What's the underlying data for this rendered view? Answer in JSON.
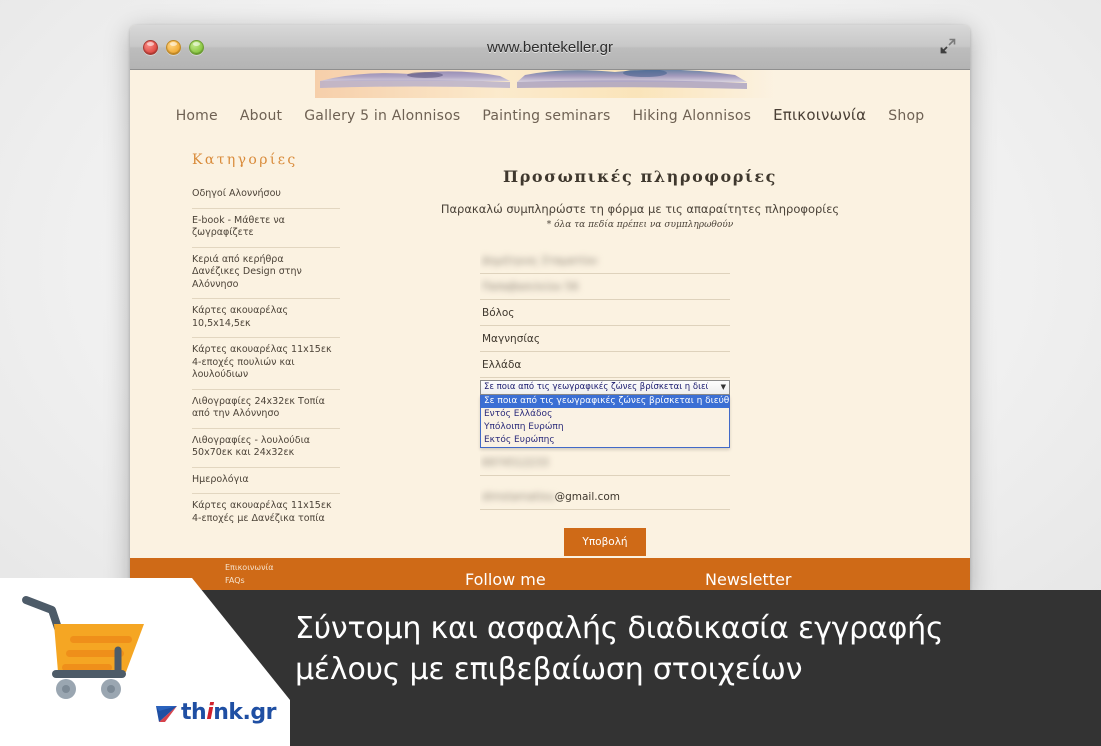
{
  "browser": {
    "url_title": "www.bentekeller.gr",
    "traffic_lights": [
      "close-button",
      "minimize-button",
      "zoom-button"
    ],
    "resize_icon": "resize-diagonal-icon"
  },
  "nav": {
    "items": [
      {
        "label": "Home",
        "active": false
      },
      {
        "label": "About",
        "active": false
      },
      {
        "label": "Gallery 5 in Alonnisos",
        "active": false
      },
      {
        "label": "Painting seminars",
        "active": false
      },
      {
        "label": "Hiking Alonnisos",
        "active": false
      },
      {
        "label": "Επικοινωνία",
        "active": true
      },
      {
        "label": "Shop",
        "active": false
      }
    ]
  },
  "sidebar": {
    "title": "Κατηγορίες",
    "items": [
      "Οδηγοί Αλοννήσου",
      "E-book - Μάθετε να ζωγραφίζετε",
      "Κεριά από κερήθρα\nΔανέζικες Design στην Αλόννησο",
      "Κάρτες ακουαρέλας 10,5x14,5εκ",
      "Κάρτες ακουαρέλας 11x15εκ 4-εποχές πουλιών και λουλούδιων",
      "Λιθογραφίες 24x32εκ Τοπία από την Αλόννησο",
      "Λιθογραφίες - λουλούδια 50x70εκ και 24x32εκ",
      "Ημερολόγια",
      "Κάρτες ακουαρέλας 11x15εκ 4-εποχές με Δανέζικα τοπία"
    ]
  },
  "form": {
    "title": "Προσωπικές πληροφορίες",
    "subtitle": "Παρακαλώ συμπληρώστε τη φόρμα με τις απαραίτητες πληροφορίες",
    "note": "* όλα τα πεδία πρέπει να συμπληρωθούν",
    "fields": [
      {
        "name": "fullname-field",
        "value": "Δημήτριος Σταματίου",
        "blurred": true
      },
      {
        "name": "address-field",
        "value": "Παπαβασιλείου 56",
        "blurred": true
      },
      {
        "name": "city-field",
        "value": "Βόλος",
        "blurred": false
      },
      {
        "name": "region-field",
        "value": "Μαγνησίας",
        "blurred": false
      },
      {
        "name": "country-field",
        "value": "Ελλάδα",
        "blurred": false
      }
    ],
    "zone_select": {
      "displayed_value": "Σε ποια από τις γεωγραφικές ζώνες βρίσκεται η διεύθυνση παραλ",
      "arrow": "▼",
      "options": [
        {
          "label": "Σε ποια από τις γεωγραφικές ζώνες βρίσκεται η διεύθυνση παραλαβής;",
          "selected": true
        },
        {
          "label": "Εντός Ελλάδος",
          "selected": false
        },
        {
          "label": "Υπόλοιπη Ευρώπη",
          "selected": false
        },
        {
          "label": "Εκτός Ευρώπης",
          "selected": false
        }
      ]
    },
    "phone_field": {
      "name": "phone-field",
      "value": "6974512233",
      "blurred": true
    },
    "email_field": {
      "name": "email-field",
      "blur_value": "dimstamatiou",
      "visible_value": "@gmail.com"
    },
    "submit_label": "Υποβολή"
  },
  "footer": {
    "links": [
      "Επικοινωνία",
      "FAQs"
    ],
    "follow_me": "Follow me",
    "newsletter": "Newsletter"
  },
  "caption": {
    "line1": "Σύντομη και ασφαλής διαδικασία εγγραφής",
    "line2": "μέλους με επιβεβαίωση στοιχείων"
  },
  "branding": {
    "logo_text_1": "th",
    "logo_text_i": "i",
    "logo_text_2": "nk.gr",
    "cart_icon": "shopping-cart-icon"
  },
  "colors": {
    "orange": "#cf6a17",
    "cart_orange": "#f5a623",
    "cream": "#fbf2e1",
    "dark_caption": "#333333",
    "logo_blue": "#1f4fa3",
    "logo_red": "#d0212b",
    "select_highlight": "#3b6fd4"
  }
}
